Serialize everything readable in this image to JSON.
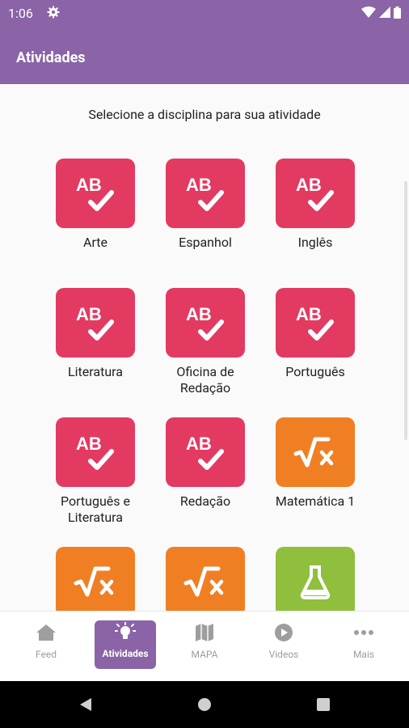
{
  "status_bar": {
    "time": "1:06"
  },
  "app_bar": {
    "title": "Atividades"
  },
  "main": {
    "subtitle": "Selecione a disciplina para sua atividade",
    "subjects": [
      {
        "label": "Arte",
        "icon": "ab-check-icon",
        "color": "#e33a61"
      },
      {
        "label": "Espanhol",
        "icon": "ab-check-icon",
        "color": "#e33a61"
      },
      {
        "label": "Inglês",
        "icon": "ab-check-icon",
        "color": "#e33a61"
      },
      {
        "label": "Literatura",
        "icon": "ab-check-icon",
        "color": "#e33a61"
      },
      {
        "label": "Oficina de Redação",
        "icon": "ab-check-icon",
        "color": "#e33a61"
      },
      {
        "label": "Português",
        "icon": "ab-check-icon",
        "color": "#e33a61"
      },
      {
        "label": "Português e Literatura",
        "icon": "ab-check-icon",
        "color": "#e33a61"
      },
      {
        "label": "Redação",
        "icon": "ab-check-icon",
        "color": "#e33a61"
      },
      {
        "label": "Matemática 1",
        "icon": "sqrt-x-icon",
        "color": "#f07f24"
      },
      {
        "label": "",
        "icon": "sqrt-x-icon",
        "color": "#f07f24"
      },
      {
        "label": "",
        "icon": "sqrt-x-icon",
        "color": "#f07f24"
      },
      {
        "label": "",
        "icon": "flask-icon",
        "color": "#8fbf3c"
      }
    ]
  },
  "bottom_nav": {
    "items": [
      {
        "label": "Feed",
        "icon": "home-icon",
        "active": false
      },
      {
        "label": "Atividades",
        "icon": "lightbulb-icon",
        "active": true
      },
      {
        "label": "MAPA",
        "icon": "map-icon",
        "active": false
      },
      {
        "label": "Videos",
        "icon": "play-circle-icon",
        "active": false
      },
      {
        "label": "Mais",
        "icon": "more-dots-icon",
        "active": false
      }
    ]
  },
  "colors": {
    "primary": "#8a64a6",
    "pink": "#e33a61",
    "orange": "#f07f24",
    "green": "#8fbf3c"
  }
}
